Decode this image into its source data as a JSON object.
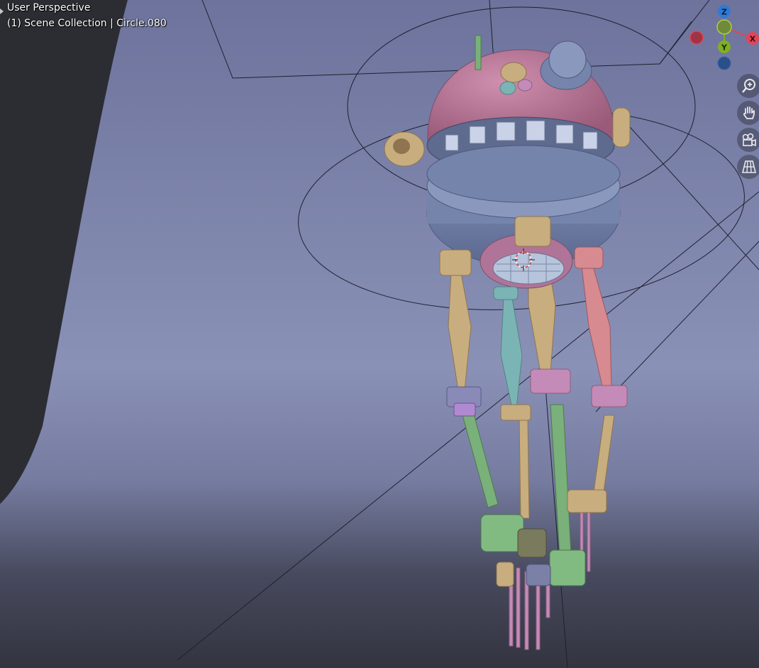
{
  "viewport": {
    "view_name": "User Perspective",
    "collection_line": "(1) Scene Collection | Circle.080"
  },
  "gizmo": {
    "axis_z": "Z",
    "axis_y": "Y",
    "axis_x": "X",
    "colors": {
      "x": "#e04658",
      "y": "#7fb024",
      "z": "#2f7ad6",
      "neg_x": "#a03346",
      "neg_z": "#2b4f8a"
    }
  },
  "nav_tools": [
    {
      "name": "zoom-icon"
    },
    {
      "name": "pan-hand-icon"
    },
    {
      "name": "camera-view-icon"
    },
    {
      "name": "ortho-grid-icon"
    }
  ],
  "colors": {
    "background": "#7a80a6",
    "floor": "#3b3d4c",
    "wall": "#2c2d33",
    "pink": "#b4708f",
    "blue": "#6f7ea4",
    "tan": "#c8ad7e",
    "green": "#7ab07a",
    "teal": "#7bb4b4"
  }
}
